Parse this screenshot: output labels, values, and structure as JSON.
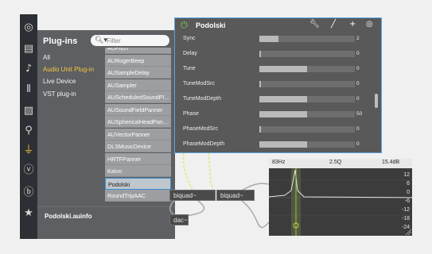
{
  "rail": {
    "icons": [
      "target-icon",
      "film-icon",
      "music-note-icon",
      "waveform-icon",
      "image-icon",
      "paperclip-icon",
      "plug-icon",
      "vst-icon",
      "beat-icon",
      "star-icon"
    ],
    "active_index": 6,
    "accent": "#f5c23a"
  },
  "browser": {
    "title": "Plug-ins",
    "categories": [
      "All",
      "Audio Unit Plug-in",
      "Live Device",
      "VST plug-in"
    ],
    "selected_category": "Audio Unit Plug-in",
    "search": {
      "placeholder": "Filter",
      "value": ""
    },
    "items": [
      "AUPitch",
      "AURogerBeep",
      "AUSampleDelay",
      "AUSampler",
      "AUScheduledSoundPl...",
      "AUSoundFieldPanner",
      "AUSphericalHeadPan...",
      "AUVectorPanner",
      "DLSMusicDevice",
      "HRTFPanner",
      "Kaivo",
      "Podolski",
      "RoundTripAAC"
    ],
    "selected_item": "Podolski",
    "footer_file": "Podolski.auinfo"
  },
  "patch": {
    "objects": [
      "biquad~",
      "biquad~",
      "dac~"
    ]
  },
  "plugin": {
    "title": "Podolski",
    "params": [
      {
        "name": "Sync",
        "value": "2",
        "level": 0.2
      },
      {
        "name": "Delay",
        "value": "0",
        "level": 0.0
      },
      {
        "name": "Tune",
        "value": "0",
        "level": 0.5
      },
      {
        "name": "TuneModSrc",
        "value": "0",
        "level": 0.0
      },
      {
        "name": "TuneModDepth",
        "value": "0",
        "level": 0.5
      },
      {
        "name": "Phase",
        "value": "50",
        "level": 0.5
      },
      {
        "name": "PhaseModSrc",
        "value": "0",
        "level": 0.0
      },
      {
        "name": "PhaseModDepth",
        "value": "0",
        "level": 0.5
      }
    ],
    "border_color": "#5ba3e0"
  },
  "spectrum": {
    "freq": "83Hz",
    "q": "2.5Q",
    "gain": "15.4dB",
    "yticks": [
      "18",
      "12",
      "6",
      "0",
      "-6",
      "-12",
      "-18",
      "-24"
    ]
  }
}
